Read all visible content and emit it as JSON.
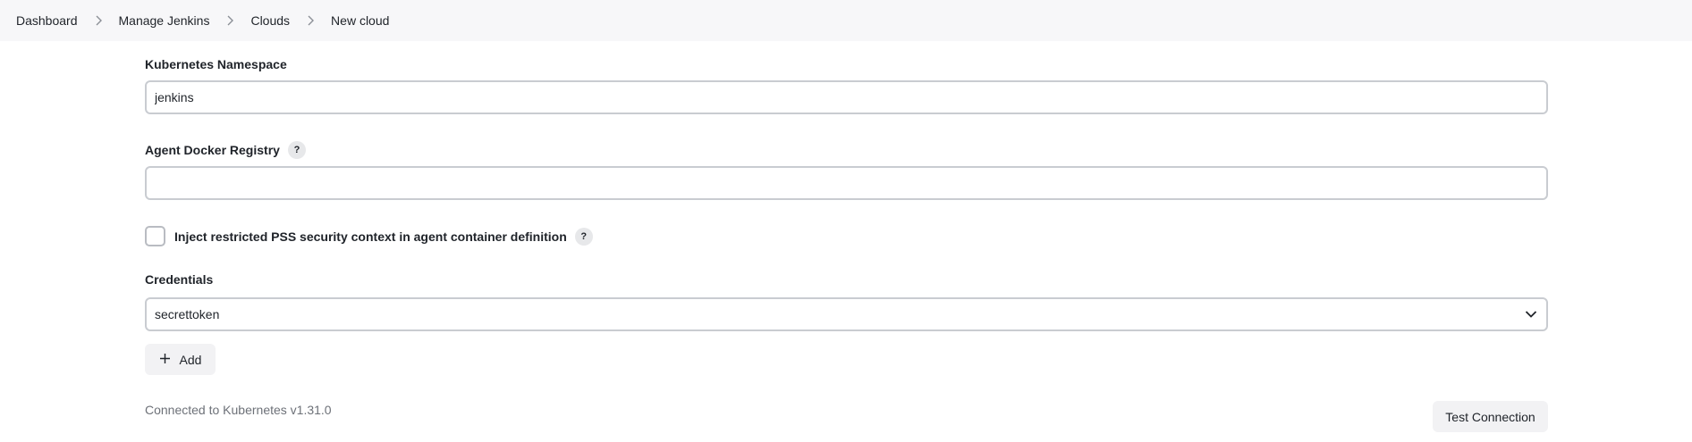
{
  "breadcrumb": {
    "items": [
      "Dashboard",
      "Manage Jenkins",
      "Clouds",
      "New cloud"
    ]
  },
  "form": {
    "namespace": {
      "label": "Kubernetes Namespace",
      "value": "jenkins"
    },
    "registry": {
      "label": "Agent Docker Registry",
      "help": "?",
      "value": ""
    },
    "pss": {
      "label": "Inject restricted PSS security context in agent container definition",
      "help": "?",
      "checked": false
    },
    "credentials": {
      "label": "Credentials",
      "selected": "secrettoken",
      "add_label": "Add"
    },
    "status": "Connected to Kubernetes v1.31.0",
    "test_label": "Test Connection"
  },
  "icons": {
    "separator": "chevron-right-icon",
    "dropdown": "chevron-down-icon",
    "add": "plus-icon",
    "help": "help-icon"
  }
}
